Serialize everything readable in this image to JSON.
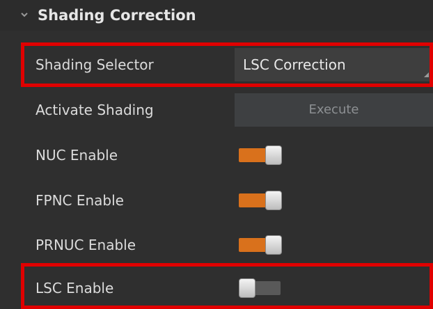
{
  "section": {
    "title": "Shading Correction",
    "icon": "chevron-down-icon"
  },
  "rows": {
    "shading_selector": {
      "label": "Shading Selector",
      "value": "LSC Correction"
    },
    "activate_shading": {
      "label": "Activate Shading",
      "button_label": "Execute"
    },
    "nuc_enable": {
      "label": "NUC Enable",
      "enabled": true
    },
    "fpnc_enable": {
      "label": "FPNC Enable",
      "enabled": true
    },
    "prnuc_enable": {
      "label": "PRNUC Enable",
      "enabled": true
    },
    "lsc_enable": {
      "label": "LSC Enable",
      "enabled": false
    }
  },
  "colors": {
    "panel_bg": "#2f2f2f",
    "toggle_on": "#d9711c",
    "toggle_off": "#595959",
    "highlight": "#e00000"
  }
}
